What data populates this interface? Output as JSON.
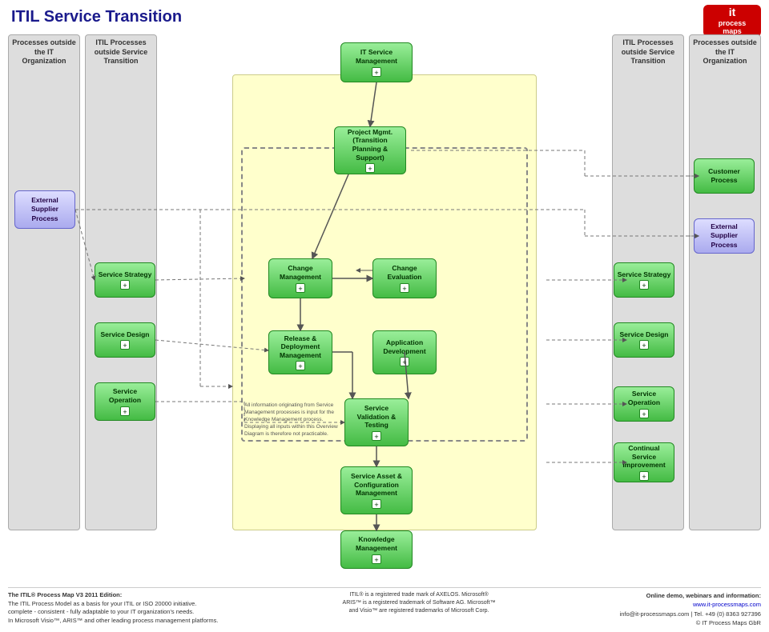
{
  "title": "ITIL Service Transition",
  "logo": {
    "line1": "it",
    "line2": "process",
    "line3": "maps"
  },
  "columns": {
    "left_outer_label": "Processes outside the IT Organization",
    "left_inner_label": "ITIL Processes outside Service Transition",
    "right_inner_label": "ITIL Processes outside Service Transition",
    "right_outer_label": "Processes outside the IT Organization"
  },
  "center_box": {
    "title": "IT Service Management",
    "plus": "+"
  },
  "left_outer_boxes": [
    {
      "label": "External\nSupplier Process",
      "plus": "+"
    }
  ],
  "left_inner_boxes": [
    {
      "label": "Service Strategy",
      "plus": "+"
    },
    {
      "label": "Service Design",
      "plus": "+"
    },
    {
      "label": "Service\nOperation",
      "plus": "+"
    }
  ],
  "center_processes": [
    {
      "id": "proj",
      "label": "Project Mgmt.\n(Transition\nPlanning &\nSupport)",
      "plus": "+"
    },
    {
      "id": "change_mgmt",
      "label": "Change\nManagement",
      "plus": "+"
    },
    {
      "id": "change_eval",
      "label": "Change\nEvaluation",
      "plus": "+"
    },
    {
      "id": "release",
      "label": "Release &\nDeployment\nManagement",
      "plus": "+"
    },
    {
      "id": "app_dev",
      "label": "Application\nDevelopment",
      "plus": "+"
    },
    {
      "id": "validation",
      "label": "Service\nValidation &\nTesting",
      "plus": "+"
    },
    {
      "id": "asset",
      "label": "Service Asset &\nConfiguration\nManagement",
      "plus": "+"
    },
    {
      "id": "knowledge",
      "label": "Knowledge\nManagement",
      "plus": "+"
    }
  ],
  "right_inner_boxes": [
    {
      "label": "Service Strategy",
      "plus": "+"
    },
    {
      "label": "Service Design",
      "plus": "+"
    },
    {
      "label": "Service\nOperation",
      "plus": "+"
    },
    {
      "label": "Continual\nService\nImprovement",
      "plus": "+"
    }
  ],
  "right_outer_boxes": [
    {
      "label": "Customer\nProcess"
    },
    {
      "label": "External\nSupplier Process"
    }
  ],
  "footer": {
    "left_bold": "The ITIL® Process Map V3 2011 Edition:",
    "left_text": "The ITIL Process Model as a basis for your ITIL or ISO 20000 initiative.\ncomplete - consistent - fully adaptable to your IT organization's needs.\nIn Microsoft Visio™, ARIS™ and other leading process management platforms.",
    "center_line1": "ITIL® is a registered trade mark of AXELOS, Microsoft®",
    "center_line2": "ARIS™ is a registered trademark of Software AG. Microsoft™",
    "center_line3": "and Visio™ are registered trademarks of Microsoft Corp.",
    "right_bold": "Online demo, webinars and information:",
    "right_url": "www.it-processmaps.com",
    "right_tel": "Tel. +49 (0) 8363 927396",
    "right_email": "info@it-processmaps.com | Tel. +49 (0) 8363 927396",
    "right_copy": "© IT Process Maps GbR"
  }
}
